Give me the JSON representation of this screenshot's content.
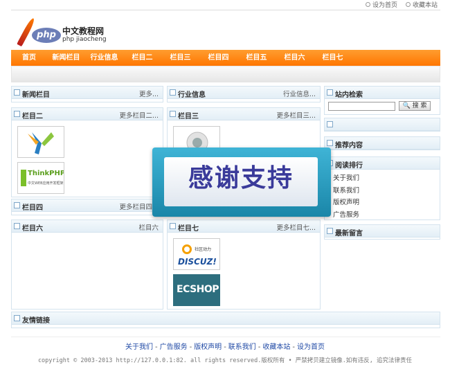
{
  "top": {
    "home": "设为首页",
    "fav": "收藏本站"
  },
  "logo": {
    "oval": "php",
    "cn": "中文教程网",
    "en": "php jiaocheng"
  },
  "nav": [
    "首页",
    "新闻栏目",
    "行业信息",
    "栏目二",
    "栏目三",
    "栏目四",
    "栏目五",
    "栏目六",
    "栏目七"
  ],
  "boxes": {
    "news": {
      "title": "新闻栏目",
      "more": "更多..."
    },
    "industry": {
      "title": "行业信息",
      "more": "行业信息..."
    },
    "col2": {
      "title": "栏目二",
      "more": "更多栏目二..."
    },
    "col3": {
      "title": "栏目三",
      "more": "更多栏目三..."
    },
    "col4": {
      "title": "栏目四",
      "more": "更多栏目四..."
    },
    "col6": {
      "title": "栏目六",
      "more": "栏目六"
    },
    "col7": {
      "title": "栏目七",
      "more": "更多栏目七..."
    },
    "links": {
      "title": "友情链接"
    }
  },
  "sidebar": {
    "search": {
      "title": "站内检索",
      "button": "搜 索"
    },
    "recommend": {
      "title": "推荐内容"
    },
    "rank": {
      "title": "阅读排行",
      "items": [
        "关于我们",
        "联系我们",
        "版权声明",
        "广告服务"
      ]
    },
    "messages": {
      "title": "最新留言"
    }
  },
  "thumbs": {
    "thinkphp": "ThinkPHP",
    "thinkphp_sub": "中文WEB应用开发框架",
    "discuz_top": "社区动力",
    "discuz": "DISCUZ!",
    "ecshop": "ECSHOP"
  },
  "banner": {
    "text": "感谢支持"
  },
  "footer": {
    "links": [
      "关于我们",
      "广告服务",
      "版权声明",
      "联系我们",
      "收藏本站",
      "设为首页"
    ],
    "separator": "-",
    "copyright": "copyright © 2003-2013 http://127.0.0.1:82. all rights reserved.版权所有 • 严禁拷贝建立镜像.如有违反, 追究法律责任"
  },
  "colors": {
    "nav": "#ff8a14",
    "link": "#1f49a5",
    "border": "#d4e3ee"
  }
}
